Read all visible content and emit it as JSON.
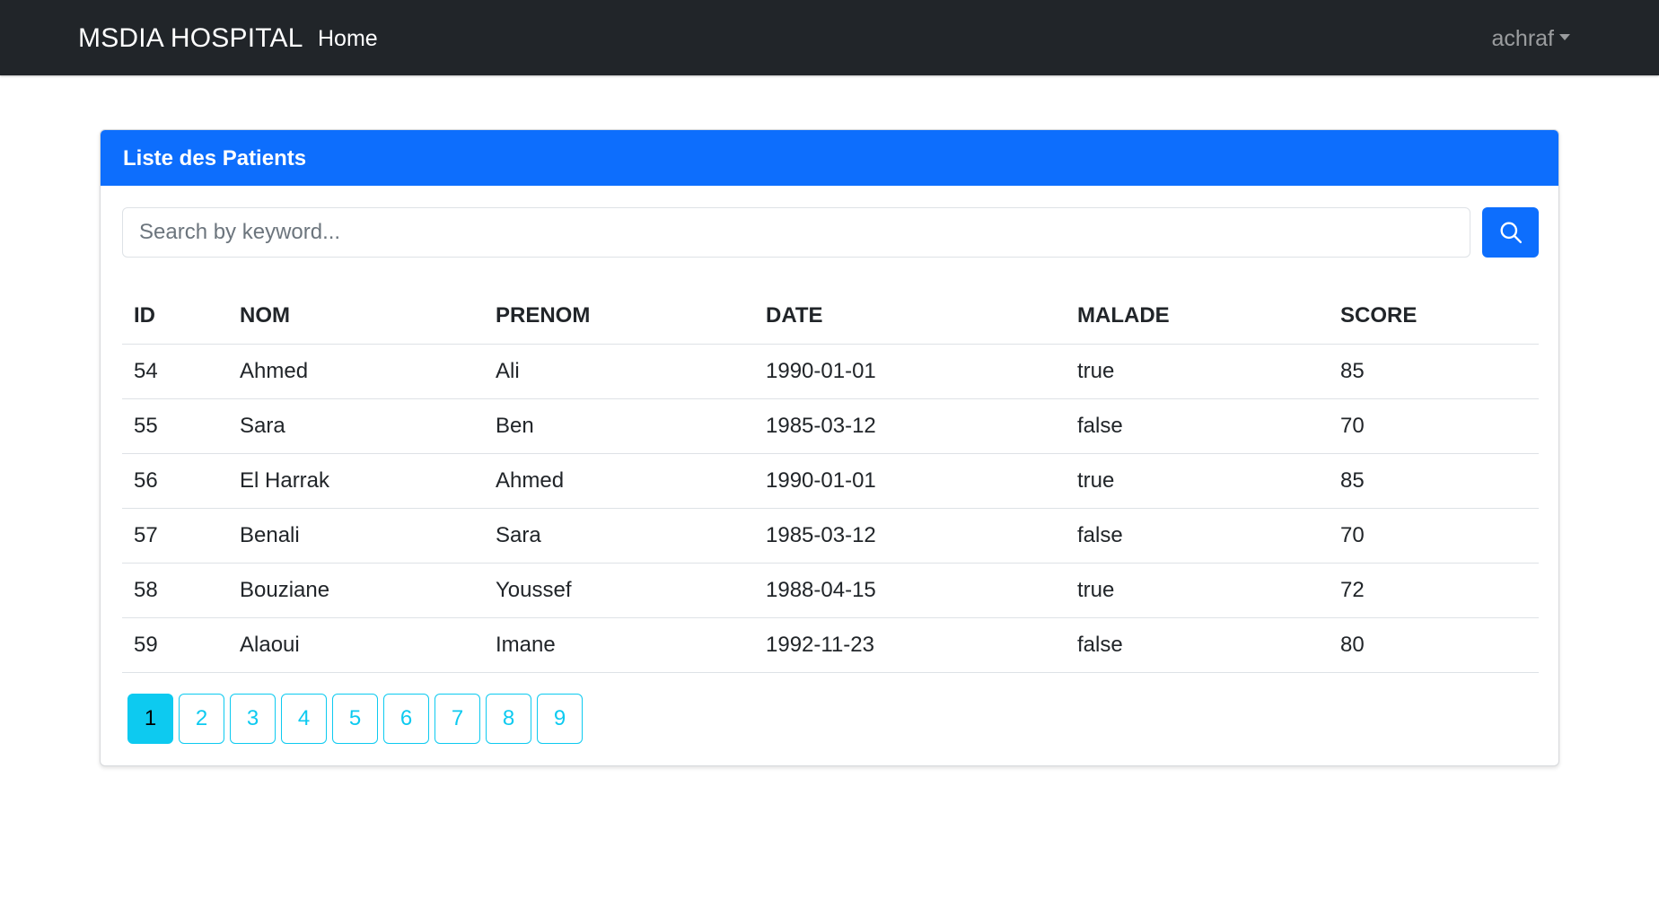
{
  "navbar": {
    "brand": "MSDIA HOSPITAL",
    "home": "Home",
    "user": "achraf",
    "user_menu_icon": "caret-down-icon"
  },
  "card": {
    "title": "Liste des Patients"
  },
  "search": {
    "placeholder": "Search by keyword...",
    "value": "",
    "button_icon": "search-icon"
  },
  "table": {
    "headers": [
      "ID",
      "NOM",
      "PRENOM",
      "DATE",
      "MALADE",
      "SCORE"
    ],
    "rows": [
      [
        "54",
        "Ahmed",
        "Ali",
        "1990-01-01",
        "true",
        "85"
      ],
      [
        "55",
        "Sara",
        "Ben",
        "1985-03-12",
        "false",
        "70"
      ],
      [
        "56",
        "El Harrak",
        "Ahmed",
        "1990-01-01",
        "true",
        "85"
      ],
      [
        "57",
        "Benali",
        "Sara",
        "1985-03-12",
        "false",
        "70"
      ],
      [
        "58",
        "Bouziane",
        "Youssef",
        "1988-04-15",
        "true",
        "72"
      ],
      [
        "59",
        "Alaoui",
        "Imane",
        "1992-11-23",
        "false",
        "80"
      ]
    ]
  },
  "pagination": {
    "pages": [
      "1",
      "2",
      "3",
      "4",
      "5",
      "6",
      "7",
      "8",
      "9"
    ],
    "current": "1"
  },
  "colors": {
    "navbar_bg": "#212529",
    "primary": "#0d6efd",
    "info": "#0dcaf0",
    "border": "#dee2e6"
  }
}
